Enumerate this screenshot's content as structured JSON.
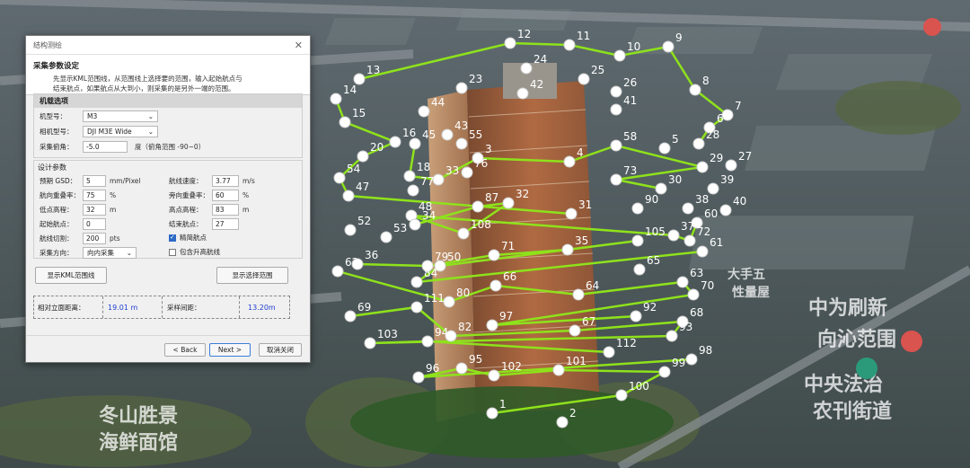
{
  "dialog": {
    "title": "结构测绘",
    "close_glyph": "✕",
    "section_title": "采集参数设定",
    "section_desc_line1": "先显示KML范围线，从范围线上选择要的范围，输入起始航点与",
    "section_desc_line2": "结束航点，如果航点从大到小，则采集的是另外一端的范围。",
    "aircraft_group": {
      "title": "机载选项",
      "model_label": "机型号：",
      "model_value": "M3",
      "camera_label": "相机型号：",
      "camera_value": "DJI M3E Wide",
      "pitch_label": "采集俯角：",
      "pitch_value": "-5.0",
      "pitch_hint": "度（俯角范围 -90~0）"
    },
    "design_group": {
      "title": "设计参数",
      "gsd_label": "预期 GSD：",
      "gsd_value": "5",
      "gsd_unit": "mm/Pixel",
      "speed_label": "航线速度：",
      "speed_value": "3.77",
      "speed_unit": "m/s",
      "front_overlap_label": "航向重叠率：",
      "front_overlap_value": "75",
      "front_overlap_unit": "%",
      "side_overlap_label": "旁向重叠率：",
      "side_overlap_value": "60",
      "side_overlap_unit": "%",
      "low_alt_label": "低点高程：",
      "low_alt_value": "32",
      "low_alt_unit": "m",
      "high_alt_label": "高点高程：",
      "high_alt_value": "83",
      "high_alt_unit": "m",
      "start_wp_label": "起始航点：",
      "start_wp_value": "0",
      "end_wp_label": "结束航点：",
      "end_wp_value": "27",
      "cut_label": "航线切割：",
      "cut_value": "200",
      "cut_unit": "pts",
      "simplify_label": "精简航点",
      "simplify_checked": true,
      "direction_label": "采集方向：",
      "direction_value": "向内采集",
      "include_ascend_label": "包含升高航线",
      "include_ascend_checked": false
    },
    "show_kml_button": "显示KML范围线",
    "show_selection_button": "显示选择范围",
    "result": {
      "distance_label": "相对立面距离：",
      "distance_value": "19.01 m",
      "interval_label": "采样间距：",
      "interval_value": "13.20m"
    },
    "back_button": "< Back",
    "next_button": "Next >",
    "cancel_button": "取消关闭"
  },
  "map": {
    "labels": [
      "冬山胜景",
      "海鲜面馆",
      "中为刷新",
      "向沁范围",
      "中央法治",
      "农刊街道",
      "大手五",
      "性量屋"
    ],
    "waypoints": [
      "12",
      "11",
      "10",
      "9",
      "13",
      "23",
      "24",
      "25",
      "26",
      "8",
      "14",
      "7",
      "15",
      "44",
      "41",
      "6",
      "28",
      "16",
      "45",
      "55",
      "58",
      "5",
      "20",
      "4",
      "29",
      "54",
      "3",
      "18",
      "33",
      "76",
      "73",
      "30",
      "39",
      "47",
      "77",
      "48",
      "87",
      "32",
      "31",
      "90",
      "38",
      "34",
      "52",
      "60",
      "108",
      "105",
      "37",
      "72",
      "61",
      "71",
      "35",
      "36",
      "79",
      "50",
      "65",
      "62",
      "84",
      "80",
      "66",
      "64",
      "63",
      "70",
      "92",
      "69",
      "111",
      "82",
      "97",
      "67",
      "68",
      "93",
      "103",
      "94",
      "112",
      "98",
      "96",
      "95",
      "102",
      "101",
      "99",
      "100",
      "1",
      "2",
      "43",
      "42",
      "27",
      "40",
      "53"
    ],
    "colors": {
      "route": "#8ee21b",
      "waypoint": "#ffffff"
    }
  }
}
